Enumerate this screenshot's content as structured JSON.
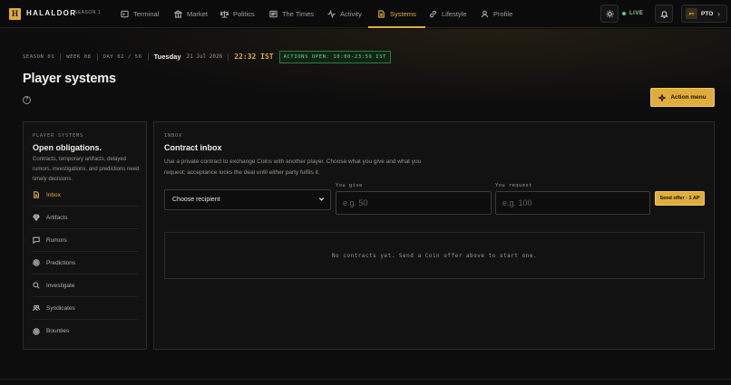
{
  "brand": {
    "logo_letter": "H",
    "name": "HALALDOR",
    "season": "SEASON 1"
  },
  "nav": [
    {
      "label": "Terminal",
      "icon": "terminal-icon",
      "active": false
    },
    {
      "label": "Market",
      "icon": "market-icon",
      "active": false
    },
    {
      "label": "Politics",
      "icon": "politics-icon",
      "active": false
    },
    {
      "label": "The Times",
      "icon": "newspaper-icon",
      "active": false
    },
    {
      "label": "Activity",
      "icon": "activity-icon",
      "active": false
    },
    {
      "label": "Systems",
      "icon": "document-icon",
      "active": true
    },
    {
      "label": "Lifestyle",
      "icon": "link-icon",
      "active": false
    },
    {
      "label": "Profile",
      "icon": "user-icon",
      "active": false
    }
  ],
  "topbar": {
    "live": "LIVE",
    "avatar_initials": "PT",
    "profile_name": "PTO"
  },
  "status": {
    "season": "SEASON 01",
    "week": "WEEK 08",
    "day": "DAY 02 / 56",
    "weekday": "Tuesday",
    "date": "21 Jul 2026",
    "time": "22:32 IST",
    "actions": "ACTIONS OPEN: 10:00-23:59 IST"
  },
  "page": {
    "title": "Player systems",
    "help": "?",
    "action_menu": "Action menu"
  },
  "sidebar": {
    "eyebrow": "PLAYER SYSTEMS",
    "heading": "Open obligations.",
    "description": "Contracts, temporary artifacts, delayed rumors, investigations, and predictions need timely decisions.",
    "items": [
      {
        "label": "Inbox",
        "icon": "inbox-icon",
        "active": true
      },
      {
        "label": "Artifacts",
        "icon": "gem-icon",
        "active": false
      },
      {
        "label": "Rumors",
        "icon": "message-icon",
        "active": false
      },
      {
        "label": "Predictions",
        "icon": "target-icon",
        "active": false
      },
      {
        "label": "Investigate",
        "icon": "search-icon",
        "active": false
      },
      {
        "label": "Syndicates",
        "icon": "users-icon",
        "active": false
      },
      {
        "label": "Bounties",
        "icon": "target-icon",
        "active": false
      }
    ]
  },
  "inbox": {
    "eyebrow": "INBOX",
    "heading": "Contract inbox",
    "description": "Use a private contract to exchange Coins with another player. Choose what you give and what you request; acceptance locks the deal until either party fulfils it.",
    "recipient_selected": "Choose recipient",
    "give_label": "You give",
    "give_placeholder": "e.g. 50",
    "request_label": "You request",
    "request_placeholder": "e.g. 100",
    "send_label": "Send offer · 1 AP",
    "empty_text": "No contracts yet. Send a Coin offer above to start one."
  },
  "colors": {
    "accent": "#e0ad3c",
    "live": "#5cd070",
    "background": "#0d0d0e"
  }
}
